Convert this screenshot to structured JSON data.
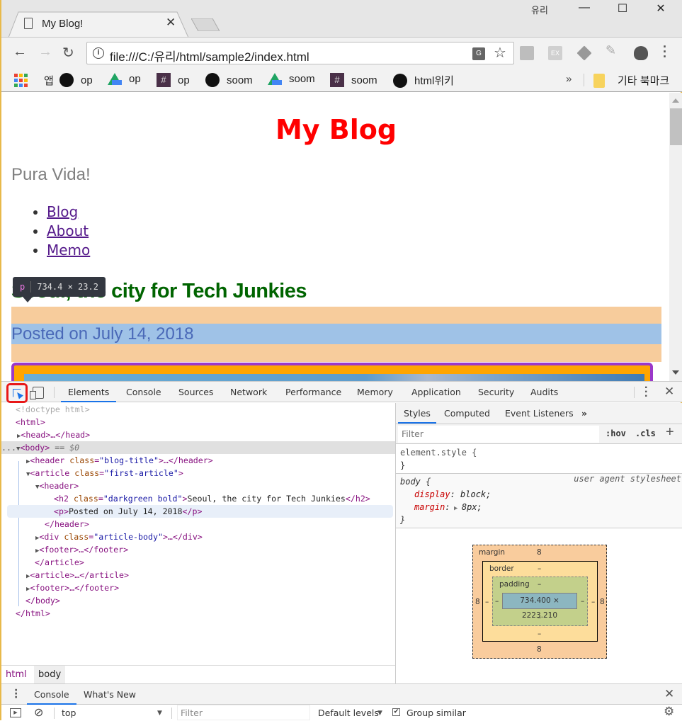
{
  "browser": {
    "tab_title": "My Blog!",
    "user_profile": "유리",
    "url": "file:///C:/유리/html/sample2/index.html",
    "bookmarks": [
      {
        "icon": "apps-icon",
        "label": "앱"
      },
      {
        "icon": "github-icon",
        "label": "op"
      },
      {
        "icon": "google-drive-icon",
        "label": "op"
      },
      {
        "icon": "slack-icon",
        "label": "op"
      },
      {
        "icon": "github-icon",
        "label": "soom"
      },
      {
        "icon": "google-drive-icon",
        "label": "soom"
      },
      {
        "icon": "slack-icon",
        "label": "soom"
      },
      {
        "icon": "github-icon",
        "label": "html위키"
      }
    ],
    "bookmarks_more": "»",
    "other_bookmarks": "기타 북마크",
    "extensions": [
      "instapaper-icon",
      "ex-icon",
      "layers-icon",
      "highlighter-icon",
      "evernote-icon"
    ]
  },
  "page": {
    "blog_title": "My Blog",
    "tagline": "Pura Vida!",
    "nav": [
      "Blog",
      "About",
      "Memo"
    ],
    "article_title": "Seoul, the city for Tech Junkies",
    "posted": "Posted on July 14, 2018",
    "inspect_tooltip": {
      "tag": "p",
      "size": "734.4 × 23.2"
    },
    "colors": {
      "blog_title": "#ff0000",
      "article_title": "#006400",
      "link": "#551a8b"
    }
  },
  "devtools": {
    "tabs": [
      "Elements",
      "Console",
      "Sources",
      "Network",
      "Performance",
      "Memory",
      "Application",
      "Security",
      "Audits"
    ],
    "active_tab": "Elements",
    "dom": [
      {
        "indent": 0,
        "text": "<!doctype html>"
      },
      {
        "indent": 0,
        "text": "<html>"
      },
      {
        "indent": 1,
        "text": "<head>…</head>"
      },
      {
        "indent": 1,
        "text": "<body> == $0"
      },
      {
        "indent": 2,
        "tag": "header",
        "attr": "class",
        "val": "blog-title",
        "rest": "…</header>"
      },
      {
        "indent": 2,
        "tag": "article",
        "attr": "class",
        "val": "first-article"
      },
      {
        "indent": 3,
        "text": "<header>"
      },
      {
        "indent": 4,
        "tag": "h2",
        "attr": "class",
        "val": "darkgreen bold",
        "inner": "Seoul, the city for Tech Junkies"
      },
      {
        "indent": 4,
        "tag": "p",
        "inner": "Posted on July 14, 2018"
      },
      {
        "indent": 3,
        "text": "</header>"
      },
      {
        "indent": 3,
        "tag": "div",
        "attr": "class",
        "val": "article-body",
        "rest": "…</div>"
      },
      {
        "indent": 3,
        "text": "<footer>…</footer>"
      },
      {
        "indent": 2,
        "text": "</article>"
      },
      {
        "indent": 2,
        "text": "<article>…</article>"
      },
      {
        "indent": 2,
        "text": "<footer>…</footer>"
      },
      {
        "indent": 1,
        "text": "</body>"
      },
      {
        "indent": 0,
        "text": "</html>"
      }
    ],
    "dom_text": {
      "doctype": "<!doctype html>",
      "html_open": "<html>",
      "head": "<head>…</head>",
      "body_tag": "<body>",
      "body_marker": "== $0",
      "header_tag": "<header",
      "class_attr": "class",
      "header_class": "\"blog-title\"",
      "header_rest": ">…</header>",
      "article_tag": "<article",
      "article_class": "\"first-article\"",
      "inner_header": "<header>",
      "h2_tag": "<h2",
      "h2_class": "\"darkgreen bold\"",
      "h2_text": "Seoul, the city for Tech Junkies",
      "h2_close": "</h2>",
      "p_open": "<p>",
      "p_text": "Posted on July 14, 2018",
      "p_close": "</p>",
      "header_close": "</header>",
      "div_tag": "<div",
      "div_class": "\"article-body\"",
      "div_rest": ">…</div>",
      "footer": "<footer>…</footer>",
      "article_close": "</article>",
      "article2": "<article>…</article>",
      "footer2": "<footer>…</footer>",
      "body_close": "</body>",
      "html_close": "</html>",
      "ellipsis": "..."
    },
    "breadcrumbs": [
      "html",
      "body"
    ],
    "styles_tabs": [
      "Styles",
      "Computed",
      "Event Listeners",
      "»"
    ],
    "filter_placeholder": "Filter",
    "hov": ":hov",
    "cls": ".cls",
    "rules": {
      "element_style_open": "element.style {",
      "close": "}",
      "body_selector": "body {",
      "ua_source": "user agent stylesheet",
      "prop1": "display",
      "val1": "block;",
      "prop2": "margin",
      "val2": "8px;"
    },
    "box_model": {
      "margin_label": "margin",
      "border_label": "border",
      "padding_label": "padding",
      "margin_top": "8",
      "margin_bottom": "8",
      "margin_left": "8",
      "margin_right": "8",
      "border_value": "–",
      "padding_value": "–",
      "content": "734.400 × 2223.210"
    },
    "drawer_tabs": [
      "Console",
      "What's New"
    ],
    "console": {
      "context": "top",
      "filter_placeholder": "Filter",
      "levels": "Default levels",
      "group_similar": "Group similar",
      "group_similar_checked": true
    }
  }
}
